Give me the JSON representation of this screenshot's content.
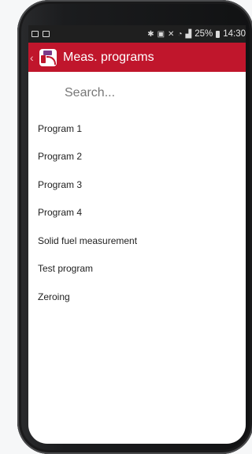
{
  "status_bar": {
    "battery": "25%",
    "time": "14:30"
  },
  "app_bar": {
    "title": "Meas. programs",
    "logo_text": "MRU"
  },
  "search": {
    "placeholder": "Search..."
  },
  "programs": [
    "Program 1",
    "Program 2",
    "Program 3",
    "Program 4",
    "Solid fuel measurement",
    "Test program",
    "Zeroing"
  ],
  "colors": {
    "app_bar": "#c0162c",
    "status_bar": "#1f1f1f"
  }
}
